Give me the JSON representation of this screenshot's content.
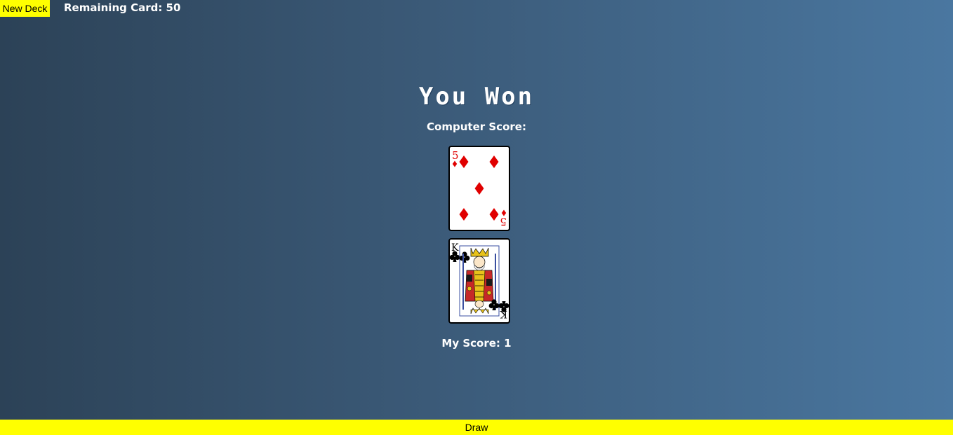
{
  "header": {
    "new_deck_label": "New Deck",
    "remaining_label": "Remaining Card: 50"
  },
  "result": {
    "title": "You Won"
  },
  "computer": {
    "score_label": "Computer Score:",
    "card": {
      "rank": "5",
      "suit": "diamonds",
      "suit_icon": "diamond-icon",
      "color": "#e00000"
    }
  },
  "player": {
    "score_label": "My Score: 1",
    "card": {
      "rank": "K",
      "suit": "clubs",
      "suit_icon": "club-icon",
      "color": "#000000"
    }
  },
  "footer": {
    "draw_label": "Draw"
  },
  "colors": {
    "button_bg": "#ffff00",
    "background_start": "#2c4257",
    "background_end": "#4a77a0"
  }
}
